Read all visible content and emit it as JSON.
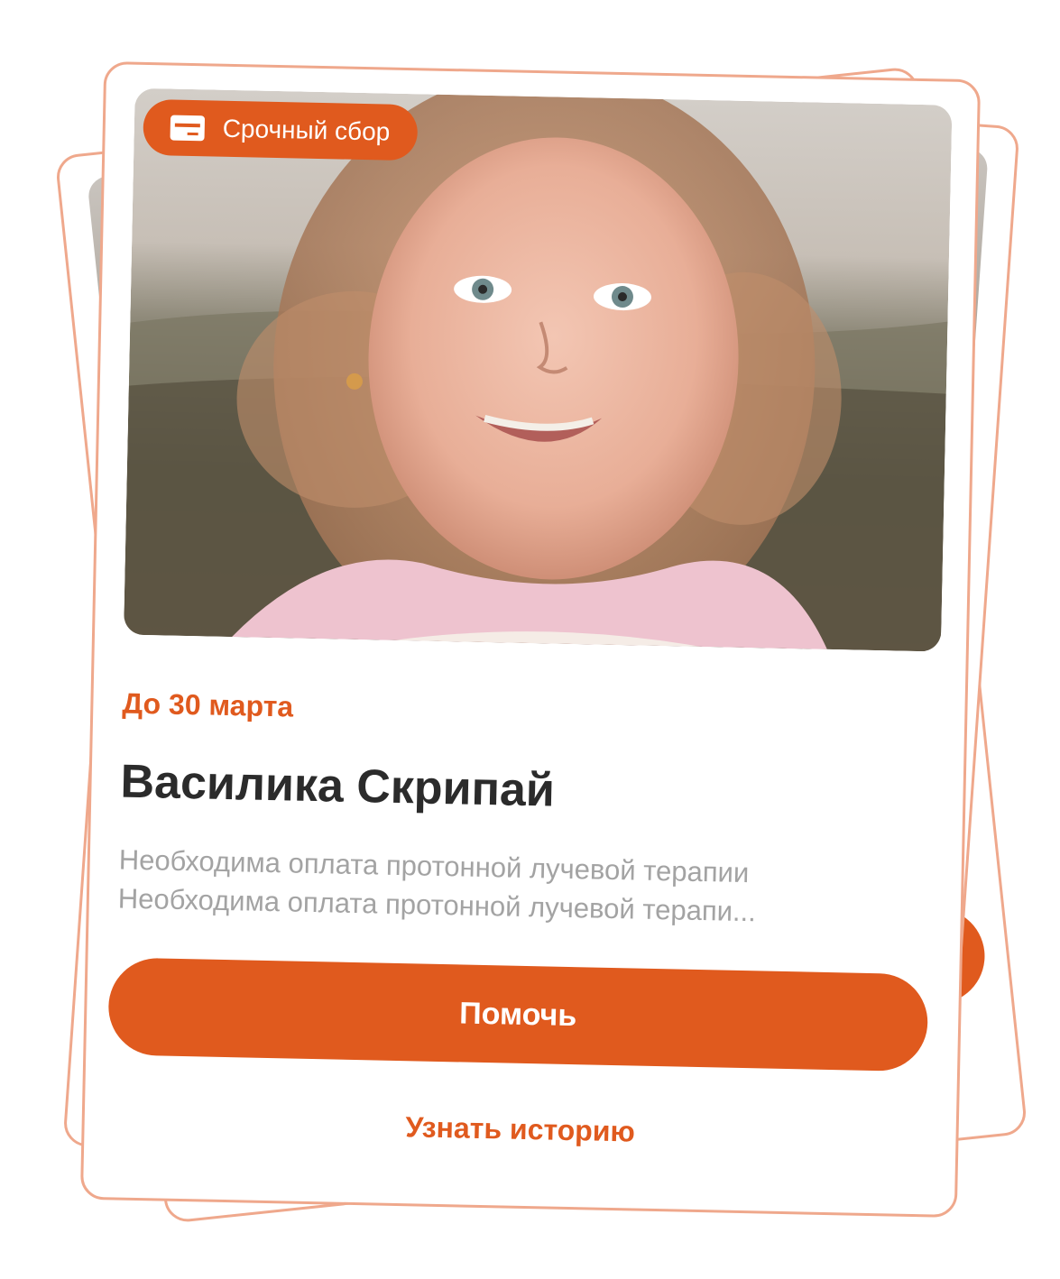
{
  "card": {
    "badge_label": "Срочный сбор",
    "badge_icon": "card-icon",
    "deadline": "До 30 марта",
    "name": "Василика Скрипай",
    "description_lines": [
      "Необходима оплата протонной лучевой терапии",
      "Необходима оплата протонной лучевой терапи..."
    ],
    "help_button_label": "Помочь",
    "story_link_label": "Узнать историю"
  },
  "colors": {
    "accent": "#e05a1e",
    "card_border": "#efa88c",
    "title": "#2b2b2b",
    "muted_text": "#a3a3a3"
  }
}
